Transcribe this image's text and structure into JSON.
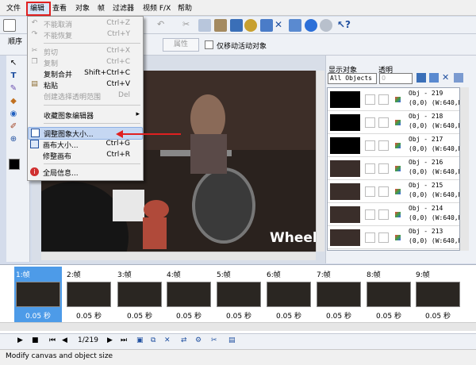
{
  "menubar": {
    "file": "文件",
    "edit": "编辑",
    "view": "查看",
    "object": "对象",
    "frame": "帧",
    "filters": "过滤器",
    "video_fx": "视频 F/X",
    "help": "帮助"
  },
  "toolbar2": {
    "order_label": "顺序",
    "properties_label": "属性",
    "move_active_label": "仅移动活动对象"
  },
  "edit_menu": [
    {
      "label": "不能取消",
      "shortcut": "Ctrl+Z",
      "disabled": true,
      "icon": "undo-icon"
    },
    {
      "label": "不能恢复",
      "shortcut": "Ctrl+Y",
      "disabled": true,
      "icon": "redo-icon"
    },
    {
      "label": "剪切",
      "shortcut": "Ctrl+X",
      "disabled": true,
      "icon": "cut-icon"
    },
    {
      "label": "复制",
      "shortcut": "Ctrl+C",
      "disabled": true,
      "icon": "copy-icon"
    },
    {
      "label": "复制合并",
      "shortcut": "Shift+Ctrl+C",
      "disabled": false,
      "icon": ""
    },
    {
      "label": "粘贴",
      "shortcut": "Ctrl+V",
      "disabled": false,
      "icon": "paste-icon"
    },
    {
      "label": "创建选择透明范围",
      "shortcut": "Del",
      "disabled": true,
      "icon": ""
    },
    {
      "label": "收藏图象编辑器",
      "shortcut": "",
      "disabled": false,
      "icon": ""
    },
    {
      "label": "调整图象大小...",
      "shortcut": "",
      "disabled": false,
      "icon": "resize-icon"
    },
    {
      "label": "画布大小...",
      "shortcut": "Ctrl+G",
      "disabled": false,
      "icon": "canvas-icon"
    },
    {
      "label": "修整画布",
      "shortcut": "Ctrl+R",
      "disabled": false,
      "icon": ""
    },
    {
      "label": "全局信息...",
      "shortcut": "",
      "disabled": false,
      "icon": "info-icon"
    }
  ],
  "video_overlay": "Wheel",
  "object_panel": {
    "show_label": "显示对象",
    "alpha_label": "透明",
    "show_value": "All Objects",
    "alpha_value": "0"
  },
  "objects": [
    {
      "name": "Obj - 219",
      "coords": "(0,0) (W:640,H:"
    },
    {
      "name": "Obj - 218",
      "coords": "(0,0) (W:640,H:"
    },
    {
      "name": "Obj - 217",
      "coords": "(0,0) (W:640,H:"
    },
    {
      "name": "Obj - 216",
      "coords": "(0,0) (W:640,H:"
    },
    {
      "name": "Obj - 215",
      "coords": "(0,0) (W:640,H:"
    },
    {
      "name": "Obj - 214",
      "coords": "(0,0) (W:640,H:"
    },
    {
      "name": "Obj - 213",
      "coords": "(0,0) (W:640,H:"
    }
  ],
  "frames": [
    {
      "label": "1:帧",
      "time": "0.05 秒"
    },
    {
      "label": "2:帧",
      "time": "0.05 秒"
    },
    {
      "label": "3:帧",
      "time": "0.05 秒"
    },
    {
      "label": "4:帧",
      "time": "0.05 秒"
    },
    {
      "label": "5:帧",
      "time": "0.05 秒"
    },
    {
      "label": "6:帧",
      "time": "0.05 秒"
    },
    {
      "label": "7:帧",
      "time": "0.05 秒"
    },
    {
      "label": "8:帧",
      "time": "0.05 秒"
    },
    {
      "label": "9:帧",
      "time": "0.05 秒"
    }
  ],
  "playback": {
    "frame_counter": "1/219"
  },
  "status": {
    "text": "Modify canvas and object size"
  },
  "colors": {
    "highlight_red": "#e02020",
    "selected_frame": "#4d9be8",
    "menu_hl": "#c5d7f2"
  }
}
